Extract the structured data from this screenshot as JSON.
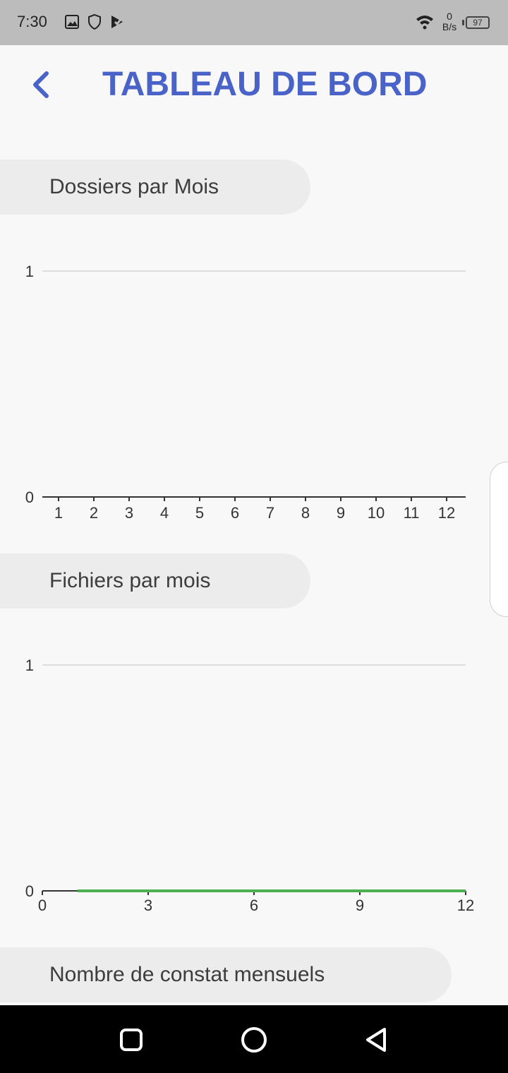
{
  "status_bar": {
    "time": "7:30",
    "icons": [
      "image-icon",
      "shield-icon",
      "play-check-icon"
    ],
    "right_icons": [
      "wifi-icon",
      "battery-icon"
    ],
    "net_speed_value": "0",
    "net_speed_unit": "B/s",
    "battery_level": "97"
  },
  "header": {
    "back_icon": "chevron-left-icon",
    "title": "TABLEAU DE BORD",
    "title_color": "#4a63c9"
  },
  "sections": [
    {
      "label": "Dossiers par Mois"
    },
    {
      "label": "Fichiers par mois"
    },
    {
      "label": "Nombre de constat mensuels"
    }
  ],
  "chart_data": [
    {
      "type": "bar",
      "title": "Dossiers par Mois",
      "categories": [
        "1",
        "2",
        "3",
        "4",
        "5",
        "6",
        "7",
        "8",
        "9",
        "10",
        "11",
        "12"
      ],
      "values": [
        0,
        0,
        0,
        0,
        0,
        0,
        0,
        0,
        0,
        0,
        0,
        0
      ],
      "y_ticks": [
        "0",
        "1"
      ],
      "ylim": [
        0,
        1
      ],
      "grid": true
    },
    {
      "type": "line",
      "title": "Fichiers par mois",
      "x": [
        1,
        2,
        3,
        4,
        5,
        6,
        7,
        8,
        9,
        10,
        11,
        12
      ],
      "values": [
        0,
        0,
        0,
        0,
        0,
        0,
        0,
        0,
        0,
        0,
        0,
        0
      ],
      "x_ticks": [
        "0",
        "3",
        "6",
        "9",
        "12"
      ],
      "y_ticks": [
        "0",
        "1"
      ],
      "xlim": [
        0,
        12
      ],
      "ylim": [
        0,
        1
      ],
      "line_color": "#4caf50",
      "grid": true
    }
  ],
  "nav_bar": {
    "buttons": [
      "recent-apps-icon",
      "home-icon",
      "back-icon"
    ]
  }
}
